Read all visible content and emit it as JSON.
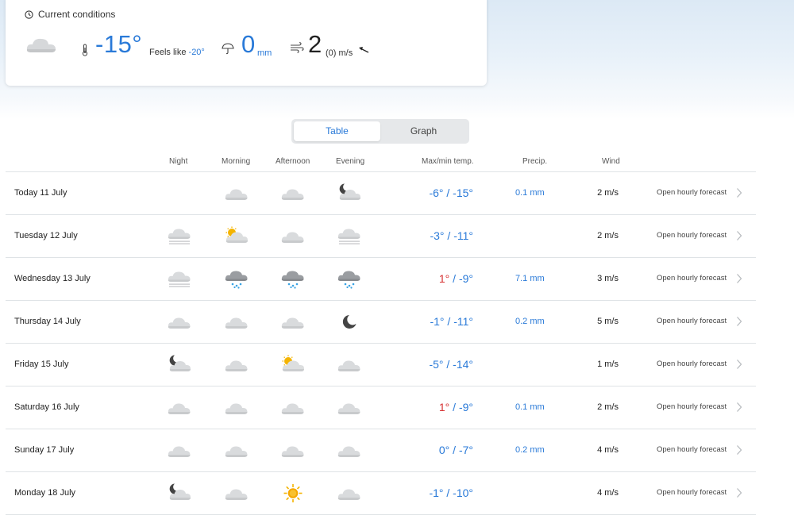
{
  "current": {
    "title": "Current conditions",
    "temperature": "-15°",
    "feels_like_label": "Feels like",
    "feels_like_value": "-20°",
    "precip_value": "0",
    "precip_unit": "mm",
    "wind_value": "2",
    "wind_unit": "(0) m/s"
  },
  "toggle": {
    "table_label": "Table",
    "graph_label": "Graph",
    "selected": "Table"
  },
  "columns": {
    "night": "Night",
    "morning": "Morning",
    "afternoon": "Afternoon",
    "evening": "Evening",
    "temp": "Max/min temp.",
    "precip": "Precip.",
    "wind": "Wind"
  },
  "hourly_label": "Open hourly forecast",
  "days": [
    {
      "day": "Today 11 July",
      "icons": [
        "",
        "cloud",
        "cloud",
        "moon-cloud"
      ],
      "max": "-6°",
      "min": "-15°",
      "max_warm": false,
      "precip": "0.1 mm",
      "wind": "2 m/s"
    },
    {
      "day": "Tuesday 12 July",
      "icons": [
        "fog-cloud",
        "sun-cloud",
        "cloud",
        "fog-cloud"
      ],
      "max": "-3°",
      "min": "-11°",
      "max_warm": false,
      "precip": "",
      "wind": "2 m/s"
    },
    {
      "day": "Wednesday 13 July",
      "icons": [
        "fog-cloud",
        "snow-cloud",
        "snow-cloud",
        "snow-cloud"
      ],
      "max": "1°",
      "min": "-9°",
      "max_warm": true,
      "precip": "7.1 mm",
      "wind": "3 m/s"
    },
    {
      "day": "Thursday 14 July",
      "icons": [
        "cloud",
        "cloud",
        "cloud",
        "moon"
      ],
      "max": "-1°",
      "min": "-11°",
      "max_warm": false,
      "precip": "0.2 mm",
      "wind": "5 m/s"
    },
    {
      "day": "Friday 15 July",
      "icons": [
        "moon-cloud",
        "cloud",
        "sun-cloud",
        "cloud"
      ],
      "max": "-5°",
      "min": "-14°",
      "max_warm": false,
      "precip": "",
      "wind": "1 m/s"
    },
    {
      "day": "Saturday 16 July",
      "icons": [
        "cloud",
        "cloud",
        "cloud",
        "cloud"
      ],
      "max": "1°",
      "min": "-9°",
      "max_warm": true,
      "precip": "0.1 mm",
      "wind": "2 m/s"
    },
    {
      "day": "Sunday 17 July",
      "icons": [
        "cloud",
        "cloud",
        "cloud",
        "cloud"
      ],
      "max": "0°",
      "min": "-7°",
      "max_warm": false,
      "precip": "0.2 mm",
      "wind": "4 m/s"
    },
    {
      "day": "Monday 18 July",
      "icons": [
        "moon-cloud",
        "cloud",
        "sun",
        "cloud"
      ],
      "max": "-1°",
      "min": "-10°",
      "max_warm": false,
      "precip": "",
      "wind": "4 m/s"
    }
  ],
  "colors": {
    "accent": "#2a7ad8",
    "warm": "#d63031",
    "divider": "#dfe3e6"
  }
}
